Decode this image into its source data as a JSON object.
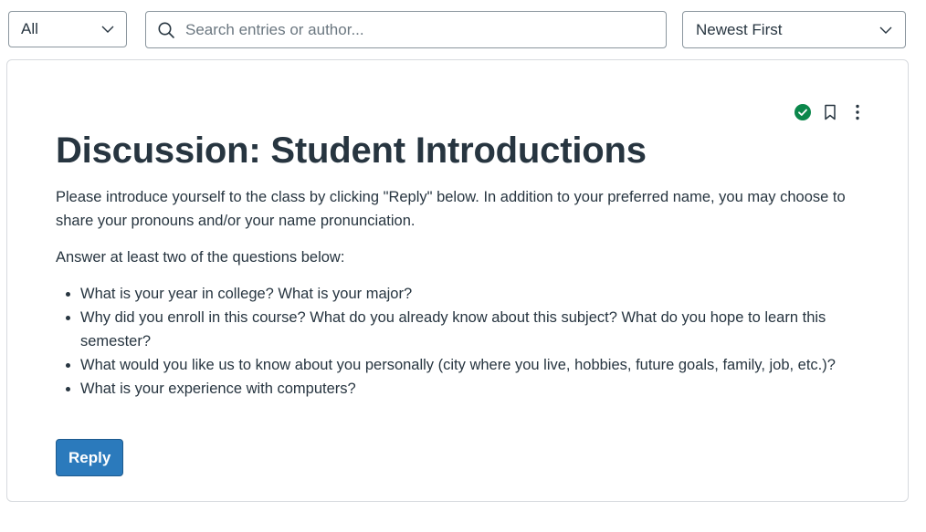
{
  "toolbar": {
    "filter": {
      "selected": "All"
    },
    "search": {
      "placeholder": "Search entries or author..."
    },
    "sort": {
      "selected": "Newest First"
    }
  },
  "discussion": {
    "title": "Discussion: Student Introductions",
    "intro": "Please introduce yourself to the class by clicking \"Reply\" below. In addition to your preferred name, you may choose to share your pronouns and/or your name pronunciation.",
    "prompt": "Answer at least two of the questions below:",
    "questions": [
      "What is your year in college? What is your major?",
      "Why did you enroll in this course? What do you already know about this subject? What do you hope to learn this semester?",
      "What would you like us to know about you personally (city where you live, hobbies, future goals, family, job, etc.)?",
      "What is your experience with computers?"
    ],
    "reply_label": "Reply"
  },
  "actions": {
    "status_icon": "check-circle-icon",
    "bookmark_icon": "bookmark-icon",
    "menu_icon": "kebab-menu-icon"
  },
  "colors": {
    "primary_button": "#2b7abc",
    "success_green": "#0b874b",
    "text": "#273540",
    "border": "#8b969e"
  }
}
